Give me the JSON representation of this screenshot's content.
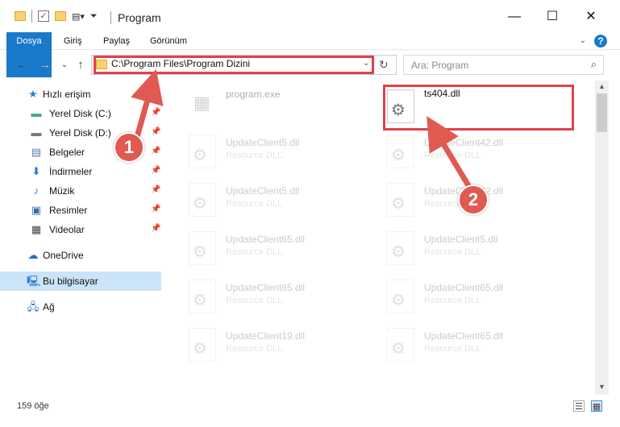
{
  "window": {
    "title": "Program"
  },
  "window_controls": {
    "minimize": "—",
    "maximize": "☐",
    "close": "✕"
  },
  "ribbon": {
    "tabs": [
      "Dosya",
      "Giriş",
      "Paylaş",
      "Görünüm"
    ]
  },
  "nav": {
    "address": "C:\\Program Files\\Program Dizini",
    "search_placeholder": "Ara: Program"
  },
  "sidebar": {
    "items": [
      {
        "label": "Hızlı erişim",
        "icon": "star-icon",
        "pinned": false
      },
      {
        "label": "Yerel Disk (C:)",
        "icon": "drive-icon",
        "pinned": true
      },
      {
        "label": "Yerel Disk (D:)",
        "icon": "drive-icon",
        "pinned": true
      },
      {
        "label": "Belgeler",
        "icon": "document-icon",
        "pinned": true
      },
      {
        "label": "İndirmeler",
        "icon": "download-icon",
        "pinned": true
      },
      {
        "label": "Müzik",
        "icon": "music-icon",
        "pinned": true
      },
      {
        "label": "Resimler",
        "icon": "picture-icon",
        "pinned": true
      },
      {
        "label": "Videolar",
        "icon": "video-icon",
        "pinned": true
      },
      {
        "label": "OneDrive",
        "icon": "cloud-icon",
        "pinned": false
      },
      {
        "label": "Bu bilgisayar",
        "icon": "computer-icon",
        "pinned": false,
        "selected": true
      },
      {
        "label": "Ağ",
        "icon": "network-icon",
        "pinned": false
      }
    ]
  },
  "files": {
    "left": [
      {
        "name": "program.exe",
        "type": ""
      },
      {
        "name": "UpdateClient5.dll",
        "type": "Resource DLL"
      },
      {
        "name": "UpdateClient5.dll",
        "type": "Resource DLL"
      },
      {
        "name": "UpdateClient65.dll",
        "type": "Resource DLL"
      },
      {
        "name": "UpdateClient65.dll",
        "type": "Resource DLL"
      },
      {
        "name": "UpdateClient19.dll",
        "type": "Resource DLL"
      }
    ],
    "right": [
      {
        "name": "ts404.dll",
        "type": ""
      },
      {
        "name": "UpdateClient42.dll",
        "type": "Resource DLL"
      },
      {
        "name": "UpdateClient42.dll",
        "type": "Resource DLL"
      },
      {
        "name": "UpdateClient5.dll",
        "type": "Resource DLL"
      },
      {
        "name": "UpdateClient65.dll",
        "type": "Resource DLL"
      },
      {
        "name": "UpdateClient65.dll",
        "type": "Resource DLL"
      }
    ]
  },
  "status": {
    "count": "159 öğe"
  },
  "annotations": {
    "step1": "1",
    "step2": "2",
    "color": "#e0414a"
  }
}
